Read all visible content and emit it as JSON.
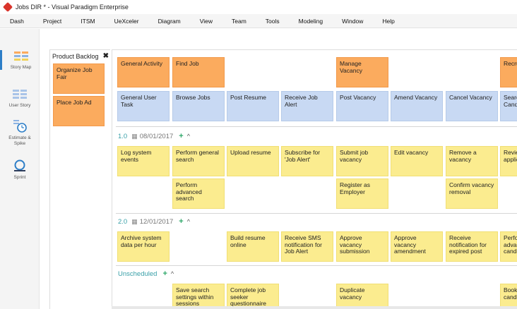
{
  "window": {
    "title": "Jobs DIR * - Visual Paradigm Enterprise"
  },
  "menu": [
    "Dash",
    "Project",
    "ITSM",
    "UeXceler",
    "Diagram",
    "View",
    "Team",
    "Tools",
    "Modeling",
    "Window",
    "Help"
  ],
  "left_tools": [
    {
      "label": "Story Map",
      "icon": "story-map-icon",
      "active": true
    },
    {
      "label": "User Story",
      "icon": "user-story-icon",
      "active": false
    },
    {
      "label": "Estimate & Spike",
      "icon": "estimate-clock-icon",
      "active": false
    },
    {
      "label": "Sprint",
      "icon": "sprint-icon",
      "active": false
    }
  ],
  "backlog": {
    "title": "Product Backlog",
    "cards": [
      "Organize Job Fair",
      "Place Job Ad"
    ]
  },
  "activities": [
    "General Activity",
    "Find Job",
    "Manage Vacancy",
    "Recruit"
  ],
  "tasks": [
    "General User Task",
    "Browse Jobs",
    "Post Resume",
    "Receive Job Alert",
    "Post Vacancy",
    "Amend Vacancy",
    "Cancel Vacancy",
    "Search Candidates"
  ],
  "releases": [
    {
      "number": "1.0",
      "date": "08/01/2017"
    },
    {
      "number": "2.0",
      "date": "12/01/2017"
    },
    {
      "number": "Unscheduled",
      "date": ""
    }
  ],
  "stories": {
    "r1_row1": [
      "Log system events",
      "Perform general search",
      "Upload resume",
      "Subscribe for 'Job Alert'",
      "Submit job vacancy",
      "Edit vacancy",
      "Remove a vacancy",
      "Review applicants"
    ],
    "r1_row2": [
      "Perform advanced search",
      "Register as Employer",
      "Confirm vacancy removal"
    ],
    "r2_row1": [
      "Archive system data per hour",
      "Build resume online",
      "Receive SMS notification for Job Alert",
      "Approve vacancy submission",
      "Approve vacancy amendment",
      "Receive notification for expired post",
      "Perform advanced candidates"
    ],
    "un_row1": [
      "Save search settings within sessions",
      "Complete job seeker questionnaire",
      "Duplicate vacancy",
      "Bookmark candidates"
    ]
  },
  "colors": {
    "activity": "#fbab5e",
    "task": "#c8d9f3",
    "story": "#fbec8f",
    "accent": "#2d7ec7"
  }
}
